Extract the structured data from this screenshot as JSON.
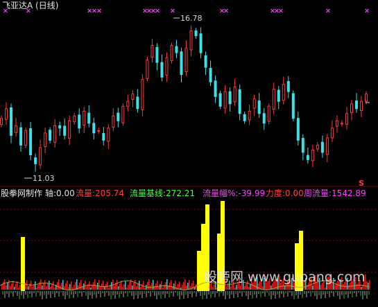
{
  "upper_panel": {
    "title": "飞亚达A (日线)",
    "high_label": "16.78",
    "low_label": "11.03",
    "signal_mark": "S",
    "colors": {
      "up": "#ff3b3b",
      "down": "#40e0e8",
      "marker": "#ff40ff",
      "text": "#e6e6e6"
    }
  },
  "indicator_bar": {
    "name": "股拳网制作",
    "items": [
      {
        "label": "轴:0.00",
        "color": "#e0e0e0"
      },
      {
        "label": "流量:205.74",
        "color": "#ff4040"
      },
      {
        "label": "流量基线:272.21",
        "color": "#40ff40"
      },
      {
        "label": "流量幅%:-39.99",
        "color": "#ff40ff"
      },
      {
        "label": "力度:0.00",
        "color": "#ff4040"
      },
      {
        "label": "周流量:1542.89",
        "color": "#ff40ff"
      }
    ]
  },
  "watermark": {
    "text": "股旁网 www.gupang.com"
  },
  "chart_data": [
    {
      "type": "candlestick",
      "title": "飞亚达A (日线)",
      "annotations": [
        {
          "text": "16.78",
          "meaning": "period high"
        },
        {
          "text": "11.03",
          "meaning": "period low"
        }
      ],
      "ylim": [
        10.5,
        17.2
      ],
      "approx_closes": [
        12.9,
        13.3,
        12.2,
        12.6,
        11.8,
        12.4,
        11.4,
        11.03,
        11.7,
        12.3,
        12.0,
        12.6,
        12.5,
        12.2,
        12.8,
        13.0,
        12.5,
        13.2,
        12.7,
        12.3,
        12.4,
        12.0,
        12.5,
        13.0,
        12.8,
        13.4,
        13.6,
        13.9,
        13.3,
        14.5,
        15.3,
        15.9,
        15.2,
        14.6,
        15.4,
        15.9,
        15.6,
        14.7,
        15.8,
        16.5,
        16.3,
        15.6,
        15.0,
        14.4,
        13.8,
        13.4,
        14.0,
        13.5,
        14.2,
        13.1,
        12.8,
        13.2,
        13.7,
        13.1,
        12.7,
        13.4,
        14.1,
        13.6,
        14.3,
        14.0,
        12.9,
        12.0,
        11.5,
        11.2,
        11.6,
        11.8,
        11.5,
        12.1,
        12.5,
        12.8,
        12.7,
        13.1,
        13.5,
        13.3,
        13.6,
        13.9
      ]
    },
    {
      "type": "bar",
      "title": "股拳网制作",
      "series": [
        {
          "name": "流量",
          "approx_values": [
            0,
            0,
            0,
            0,
            0,
            0,
            0,
            85,
            0,
            0,
            0,
            0,
            0,
            0,
            0,
            0,
            0,
            0,
            0,
            0,
            0,
            0,
            0,
            0,
            0,
            0,
            0,
            0,
            0,
            0,
            0,
            0,
            0,
            0,
            0,
            0,
            0,
            0,
            0,
            0,
            0,
            0,
            0,
            0,
            0,
            0,
            0,
            0,
            0,
            0,
            0,
            0,
            0,
            0,
            0,
            0,
            0,
            60,
            140,
            150,
            0,
            0,
            0,
            0,
            0,
            150,
            155,
            0,
            0,
            0,
            0,
            0,
            0,
            0,
            0,
            0,
            0,
            0,
            0,
            0,
            0,
            0,
            0,
            0,
            0,
            0,
            0,
            0,
            0,
            90,
            0,
            0,
            0,
            0,
            0,
            0,
            0,
            0,
            0,
            0,
            0,
            0,
            0,
            0,
            0,
            0,
            0,
            0
          ]
        }
      ]
    }
  ]
}
